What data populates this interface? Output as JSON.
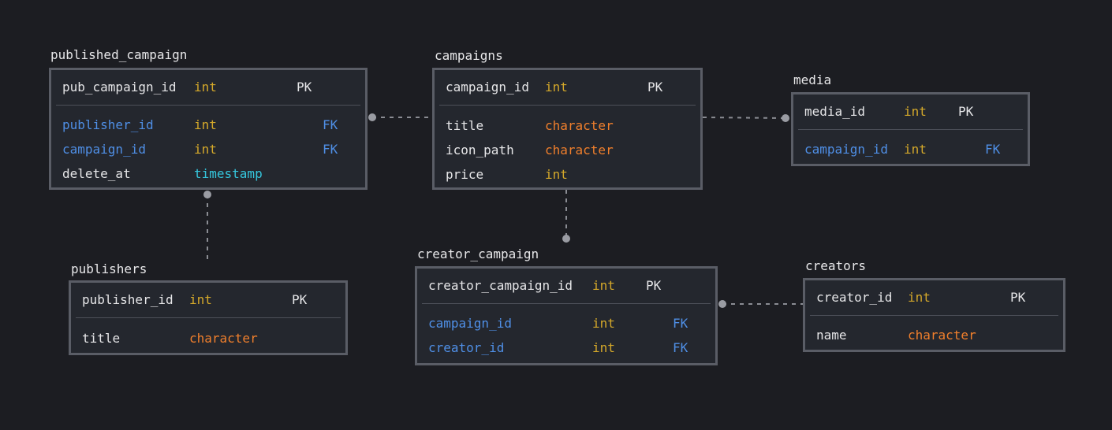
{
  "diagram": {
    "tables": [
      {
        "name": "published_campaign",
        "columns": [
          {
            "name": "pub_campaign_id",
            "type": "int",
            "key": "PK"
          },
          {
            "name": "publisher_id",
            "type": "int",
            "key": "FK"
          },
          {
            "name": "campaign_id",
            "type": "int",
            "key": "FK"
          },
          {
            "name": "delete_at",
            "type": "timestamp",
            "key": ""
          }
        ]
      },
      {
        "name": "campaigns",
        "columns": [
          {
            "name": "campaign_id",
            "type": "int",
            "key": "PK"
          },
          {
            "name": "title",
            "type": "character",
            "key": ""
          },
          {
            "name": "icon_path",
            "type": "character",
            "key": ""
          },
          {
            "name": "price",
            "type": "int",
            "key": ""
          }
        ]
      },
      {
        "name": "media",
        "columns": [
          {
            "name": "media_id",
            "type": "int",
            "key": "PK"
          },
          {
            "name": "campaign_id",
            "type": "int",
            "key": "FK"
          }
        ]
      },
      {
        "name": "publishers",
        "columns": [
          {
            "name": "publisher_id",
            "type": "int",
            "key": "PK"
          },
          {
            "name": "title",
            "type": "character",
            "key": ""
          }
        ]
      },
      {
        "name": "creator_campaign",
        "columns": [
          {
            "name": "creator_campaign_id",
            "type": "int",
            "key": "PK"
          },
          {
            "name": "campaign_id",
            "type": "int",
            "key": "FK"
          },
          {
            "name": "creator_id",
            "type": "int",
            "key": "FK"
          }
        ]
      },
      {
        "name": "creators",
        "columns": [
          {
            "name": "creator_id",
            "type": "int",
            "key": "PK"
          },
          {
            "name": "name",
            "type": "character",
            "key": ""
          }
        ]
      }
    ],
    "relations": [
      {
        "from": "published_campaign",
        "to": "campaigns"
      },
      {
        "from": "campaigns",
        "to": "media"
      },
      {
        "from": "published_campaign",
        "to": "publishers"
      },
      {
        "from": "campaigns",
        "to": "creator_campaign"
      },
      {
        "from": "creator_campaign",
        "to": "creators"
      }
    ],
    "colors": {
      "background": "#1c1d22",
      "table_fill": "#24272e",
      "table_border": "#5a5d66",
      "fk_column": "#4f8fe6",
      "type_int": "#d4a82a",
      "type_character": "#f07f2c",
      "type_timestamp": "#35c6dd",
      "connector": "#8a8c93"
    }
  }
}
